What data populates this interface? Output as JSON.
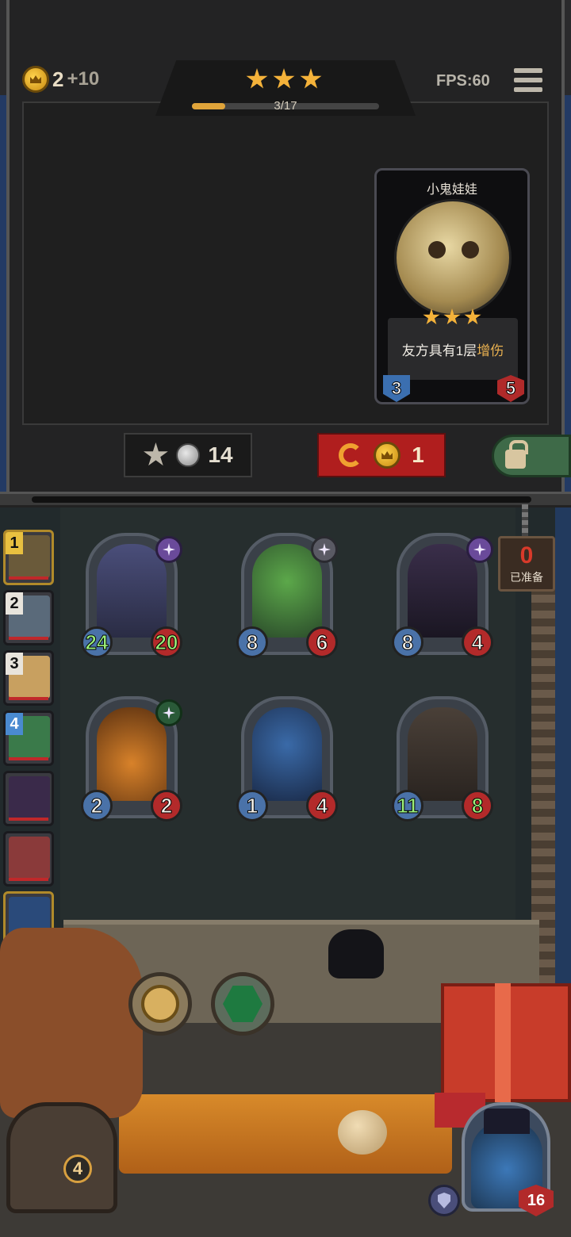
{
  "hud": {
    "gold": "2",
    "gold_income": "+10",
    "tier_progress": "3/17",
    "tier_progress_fraction": 0.18,
    "tier_stars": 3,
    "fps": "FPS:60"
  },
  "shop_card": {
    "name": "小鬼娃娃",
    "desc_prefix": "友方具有1层",
    "desc_highlight": "增伤",
    "attack": "3",
    "health": "5",
    "stars": 3
  },
  "shop_buttons": {
    "upgrade_cost": "14",
    "refresh_cost": "1"
  },
  "ready": {
    "count": "0",
    "label": "已准备"
  },
  "board_units": [
    {
      "attack": "24",
      "health": "20",
      "badge": "sparkle-icon"
    },
    {
      "attack": "8",
      "health": "6",
      "badge": "flame-icon"
    },
    {
      "attack": "8",
      "health": "4",
      "badge": "sparkle-icon"
    },
    {
      "attack": "2",
      "health": "2",
      "badge": "swirl-icon"
    },
    {
      "attack": "1",
      "health": "4",
      "badge": ""
    },
    {
      "attack": "11",
      "health": "8",
      "badge": ""
    }
  ],
  "roster": [
    {
      "label": "1"
    },
    {
      "label": "2"
    },
    {
      "label": "3"
    },
    {
      "label": "4"
    },
    {
      "label": ""
    },
    {
      "label": ""
    },
    {
      "label": ""
    },
    {
      "label": ""
    }
  ],
  "chest": {
    "count": "4"
  },
  "hero": {
    "health": "16"
  },
  "colors": {
    "gold": "#f4b23a",
    "refresh_red": "#b01e1e",
    "lock_green": "#3e6a48",
    "buffed_stat": "#9cf07a"
  }
}
